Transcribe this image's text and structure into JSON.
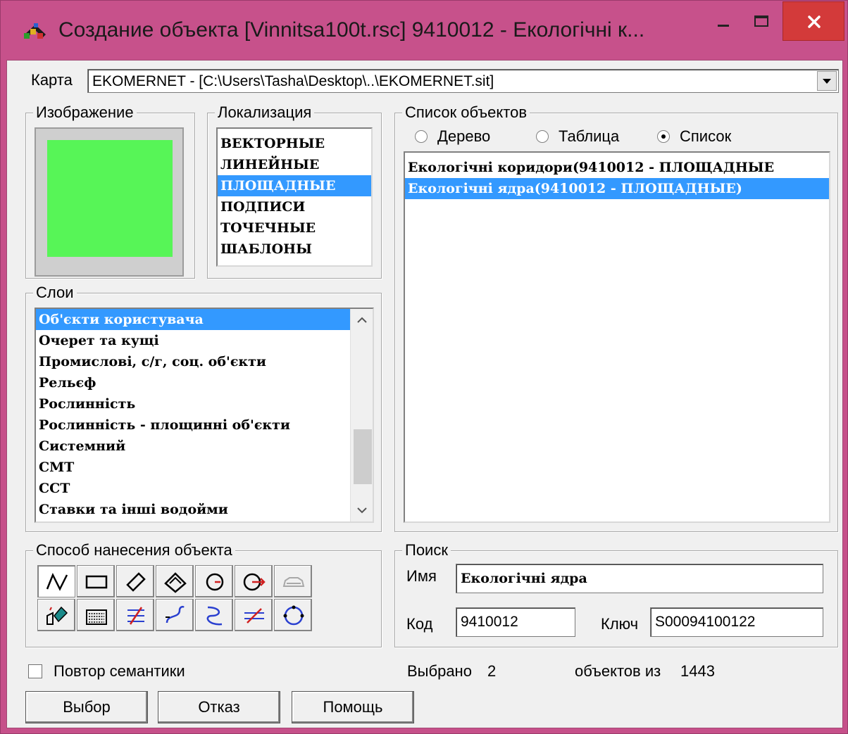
{
  "window": {
    "title": "Создание объекта  [Vinnitsa100t.rsc]  9410012 - Екологічні к...",
    "minimize_glyph": "–",
    "maximize_glyph": "☐",
    "close_glyph": "✕"
  },
  "map": {
    "label": "Карта",
    "value": "EKOMERNET - [C:\\Users\\Tasha\\Desktop\\..\\EKOMERNET.sit]"
  },
  "image_group": {
    "title": "Изображение",
    "fill_color": "#57f557"
  },
  "localization": {
    "title": "Локализация",
    "items": [
      "ВЕКТОРНЫЕ",
      "ЛИНЕЙНЫЕ",
      "ПЛОЩАДНЫЕ",
      "ПОДПИСИ",
      "ТОЧЕЧНЫЕ",
      "ШАБЛОНЫ"
    ],
    "selected_index": 2
  },
  "object_list": {
    "title": "Список объектов",
    "view_modes": [
      "Дерево",
      "Таблица",
      "Список"
    ],
    "selected_mode": 2,
    "items": [
      "Екологічні коридори(9410012 - ПЛОЩАДНЫЕ",
      "Екологічні ядра(9410012 - ПЛОЩАДНЫЕ)"
    ],
    "selected_index": 1
  },
  "layers": {
    "title": "Слои",
    "items": [
      "Об'єкти користувача",
      "Очерет та кущі",
      "Промислові, с/г, соц. об'єкти",
      "Рельєф",
      "Рослинність",
      "Рослинність - площинні об'єкти",
      "Системний",
      "СМТ",
      "ССТ",
      "Ставки та інші водойми"
    ],
    "selected_index": 0
  },
  "placement": {
    "title": "Способ нанесения объекта"
  },
  "search": {
    "title": "Поиск",
    "name_label": "Имя",
    "name_value": "Екологічні ядра",
    "code_label": "Код",
    "code_value": "9410012",
    "key_label": "Ключ",
    "key_value": "S00094100122"
  },
  "repeat_semantics": {
    "label": "Повтор семантики",
    "checked": false
  },
  "status": {
    "selected_label": "Выбрано",
    "selected_count": "2",
    "of_label": "объектов из",
    "total": "1443"
  },
  "buttons": {
    "select": "Выбор",
    "cancel": "Отказ",
    "help": "Помощь"
  },
  "colors": {
    "titlebar": "#c7518b",
    "selection": "#3399ff",
    "close": "#d33a3a"
  }
}
